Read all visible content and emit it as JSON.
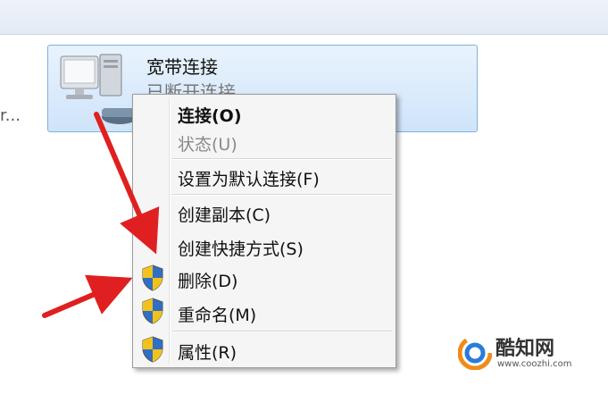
{
  "background": {
    "truncated_text": "r..."
  },
  "connection": {
    "name": "宽带连接",
    "status": "已断开连接",
    "icon": "network-computer-icon"
  },
  "context_menu": {
    "items": [
      {
        "label": "连接(O)",
        "style": "bold"
      },
      {
        "label": "状态(U)",
        "style": "disabled"
      },
      {
        "label": "设置为默认连接(F)",
        "style": "normal"
      },
      {
        "label": "创建副本(C)",
        "style": "normal"
      },
      {
        "label": "创建快捷方式(S)",
        "style": "normal"
      },
      {
        "label": "删除(D)",
        "style": "normal",
        "icon": "shield-icon"
      },
      {
        "label": "重命名(M)",
        "style": "normal",
        "icon": "shield-icon"
      },
      {
        "label": "属性(R)",
        "style": "normal",
        "icon": "shield-icon"
      }
    ]
  },
  "annotations": {
    "arrow_color": "#e02020"
  },
  "watermark": {
    "title": "酷知网",
    "url": "www.coozhi.com"
  },
  "colors": {
    "tile_border": "#7fb0e0",
    "menu_bg": "#f5f5f5"
  }
}
